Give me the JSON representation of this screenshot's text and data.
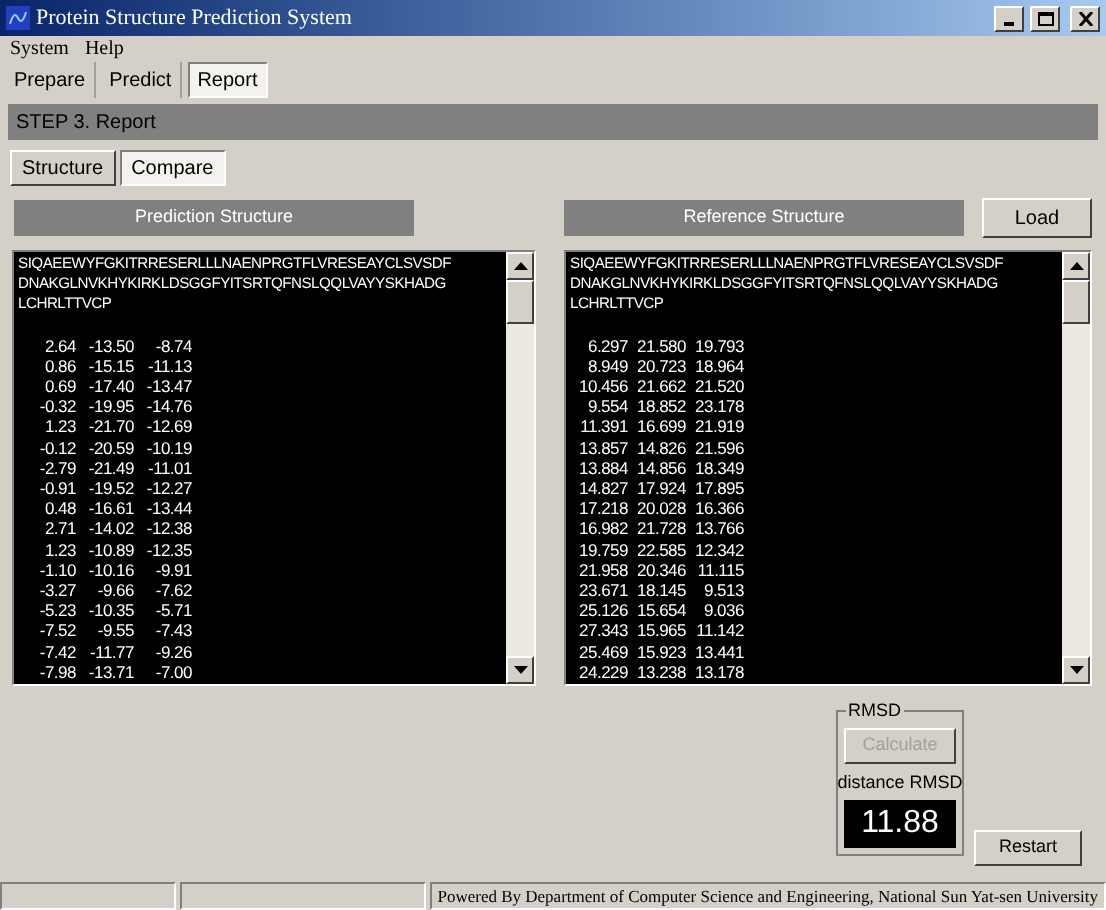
{
  "window": {
    "title": "Protein Structure Prediction System"
  },
  "menu": [
    {
      "label": "System"
    },
    {
      "label": "Help"
    }
  ],
  "tabs": [
    {
      "label": "Prepare",
      "selected": false
    },
    {
      "label": "Predict",
      "selected": false
    },
    {
      "label": "Report",
      "selected": true
    }
  ],
  "step_bar": {
    "label": "STEP 3. Report"
  },
  "sub_tabs": [
    {
      "label": "Structure",
      "selected": false
    },
    {
      "label": "Compare",
      "selected": true
    }
  ],
  "prediction": {
    "header": "Prediction Structure",
    "sequence": [
      "SIQAEEWYFGKITRRESERLLLNAENPRGTFLVRESEAYCLSVSDF",
      "DNAKGLNVKHYKIRKLDSGGFYITSRTQFNSLQQLVAYYSKHADG",
      "LCHRLTTVCP"
    ],
    "rows": [
      [
        "2.64",
        "-13.50",
        "-8.74"
      ],
      [
        "0.86",
        "-15.15",
        "-11.13"
      ],
      [
        "0.69",
        "-17.40",
        "-13.47"
      ],
      [
        "-0.32",
        "-19.95",
        "-14.76"
      ],
      [
        "1.23",
        "-21.70",
        "-12.69"
      ],
      [
        "-0.12",
        "-20.59",
        "-10.19"
      ],
      [
        "-2.79",
        "-21.49",
        "-11.01"
      ],
      [
        "-0.91",
        "-19.52",
        "-12.27"
      ],
      [
        "0.48",
        "-16.61",
        "-13.44"
      ],
      [
        "2.71",
        "-14.02",
        "-12.38"
      ],
      [
        "1.23",
        "-10.89",
        "-12.35"
      ],
      [
        "-1.10",
        "-10.16",
        "-9.91"
      ],
      [
        "-3.27",
        "-9.66",
        "-7.62"
      ],
      [
        "-5.23",
        "-10.35",
        "-5.71"
      ],
      [
        "-7.52",
        "-9.55",
        "-7.43"
      ],
      [
        "-7.42",
        "-11.77",
        "-9.26"
      ],
      [
        "-7.98",
        "-13.71",
        "-7.00"
      ]
    ]
  },
  "reference": {
    "header": "Reference Structure",
    "load_button": "Load",
    "sequence": [
      "SIQAEEWYFGKITRRESERLLLNAENPRGTFLVRESEAYCLSVSDF",
      "DNAKGLNVKHYKIRKLDSGGFYITSRTQFNSLQQLVAYYSKHADG",
      "LCHRLTTVCP"
    ],
    "rows": [
      [
        "6.297",
        "21.580",
        "19.793"
      ],
      [
        "8.949",
        "20.723",
        "18.964"
      ],
      [
        "10.456",
        "21.662",
        "21.520"
      ],
      [
        "9.554",
        "18.852",
        "23.178"
      ],
      [
        "11.391",
        "16.699",
        "21.919"
      ],
      [
        "13.857",
        "14.826",
        "21.596"
      ],
      [
        "13.884",
        "14.856",
        "18.349"
      ],
      [
        "14.827",
        "17.924",
        "17.895"
      ],
      [
        "17.218",
        "20.028",
        "16.366"
      ],
      [
        "16.982",
        "21.728",
        "13.766"
      ],
      [
        "19.759",
        "22.585",
        "12.342"
      ],
      [
        "21.958",
        "20.346",
        "11.115"
      ],
      [
        "23.671",
        "18.145",
        "9.513"
      ],
      [
        "25.126",
        "15.654",
        "9.036"
      ],
      [
        "27.343",
        "15.965",
        "11.142"
      ],
      [
        "25.469",
        "15.923",
        "13.441"
      ],
      [
        "24.229",
        "13.238",
        "13.178"
      ]
    ]
  },
  "rmsd": {
    "group_label": "RMSD",
    "calculate_button": {
      "label": "Calculate",
      "disabled": true
    },
    "result_label": "distance RMSD",
    "value": "11.88"
  },
  "restart_button": "Restart",
  "status_bar": {
    "text": "Powered By Department of Computer Science and Engineering, National Sun Yat-sen University"
  }
}
